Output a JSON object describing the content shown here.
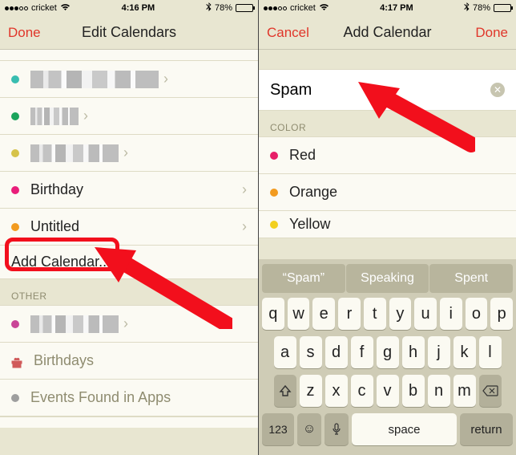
{
  "left": {
    "status": {
      "carrier": "cricket",
      "time": "4:16 PM",
      "battery_pct": "78%"
    },
    "nav": {
      "done": "Done",
      "title": "Edit Calendars"
    },
    "rows": {
      "birthday": "Birthday",
      "untitled": "Untitled",
      "add": "Add Calendar..."
    },
    "other_header": "OTHER",
    "birthdays": "Birthdays",
    "events_found": "Events Found in Apps",
    "colors": {
      "c01": "#38bdb0",
      "c02": "#1aa45b",
      "c03": "#d6c34a",
      "c04": "#e91e7a",
      "c05": "#f29b1f",
      "c06": "#c94597",
      "c07": "#9e9e9e"
    }
  },
  "right": {
    "status": {
      "carrier": "cricket",
      "time": "4:17 PM",
      "battery_pct": "78%"
    },
    "nav": {
      "cancel": "Cancel",
      "title": "Add Calendar",
      "done": "Done"
    },
    "input_value": "Spam",
    "color_header": "COLOR",
    "colors": {
      "red": {
        "label": "Red",
        "hex": "#e71e67"
      },
      "orange": {
        "label": "Orange",
        "hex": "#f29b1f"
      },
      "yellow": {
        "label": "Yellow",
        "hex": "#f2d01f"
      }
    },
    "suggestions": [
      "“Spam”",
      "Speaking",
      "Spent"
    ],
    "keyboard": {
      "row1": [
        "q",
        "w",
        "e",
        "r",
        "t",
        "y",
        "u",
        "i",
        "o",
        "p"
      ],
      "row2": [
        "a",
        "s",
        "d",
        "f",
        "g",
        "h",
        "j",
        "k",
        "l"
      ],
      "row3": [
        "z",
        "x",
        "c",
        "v",
        "b",
        "n",
        "m"
      ],
      "numKey": "123",
      "space": "space",
      "return": "return"
    }
  }
}
